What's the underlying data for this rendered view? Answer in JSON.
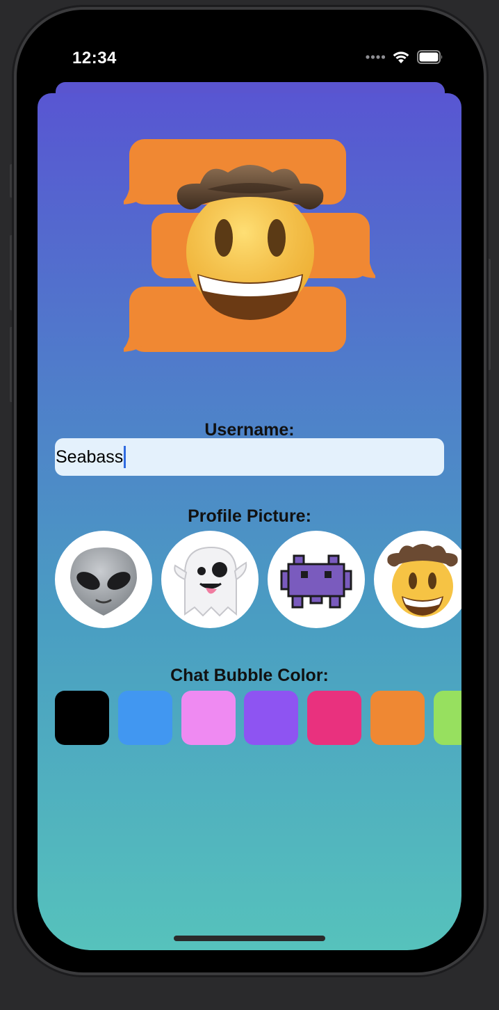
{
  "status_bar": {
    "time": "12:34",
    "icons": [
      "signal-dots-icon",
      "wifi-icon",
      "battery-icon"
    ]
  },
  "logo": {
    "emoji": "cowboy-hat-face",
    "bubble_color": "#F08833"
  },
  "username": {
    "label": "Username:",
    "value": "Seabass"
  },
  "profile_picture": {
    "label": "Profile Picture:",
    "options": [
      "alien",
      "ghost",
      "alien-monster",
      "cowboy-hat-face"
    ],
    "selected": "cowboy-hat-face"
  },
  "chat_bubble_color": {
    "label": "Chat Bubble Color:",
    "options": [
      {
        "name": "black",
        "hex": "#000000"
      },
      {
        "name": "blue",
        "hex": "#4197F1"
      },
      {
        "name": "pink",
        "hex": "#EF8AF2"
      },
      {
        "name": "purple",
        "hex": "#8E54F2"
      },
      {
        "name": "magenta",
        "hex": "#E9317E"
      },
      {
        "name": "orange",
        "hex": "#EF8833"
      },
      {
        "name": "green",
        "hex": "#97E05F"
      }
    ],
    "selected": "orange"
  },
  "theme": {
    "gradient_top": "#5856D2",
    "gradient_bottom": "#56C2BC"
  }
}
